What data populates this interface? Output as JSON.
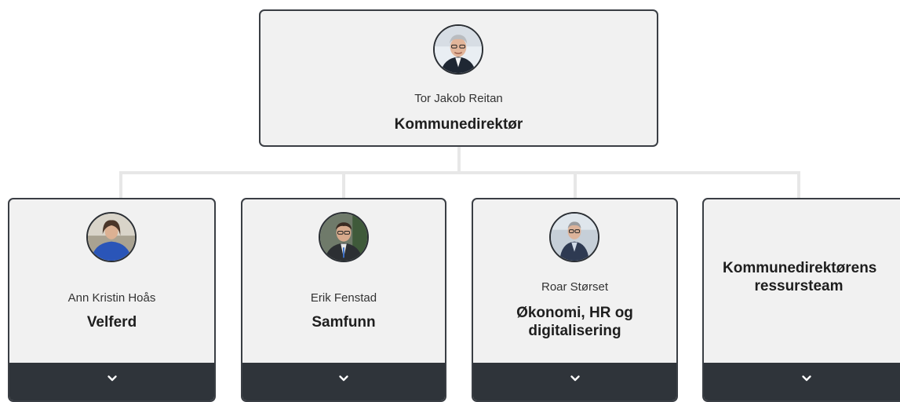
{
  "root": {
    "name": "Tor Jakob Reitan",
    "role": "Kommunedirektør",
    "photo": "person-portrait"
  },
  "children": [
    {
      "name": "Ann Kristin Hoås",
      "role": "Velferd",
      "photo": "person-portrait"
    },
    {
      "name": "Erik Fenstad",
      "role": "Samfunn",
      "photo": "person-portrait"
    },
    {
      "name": "Roar Størset",
      "role": "Økonomi, HR og digitalisering",
      "photo": "person-portrait"
    },
    {
      "name": "",
      "role": "Kommunedirektørens ressursteam",
      "photo": ""
    }
  ],
  "footer": {
    "icon": "chevron-down-icon"
  },
  "colors": {
    "card_bg": "#f1f1f1",
    "card_border": "#3a3e44",
    "footer_bg": "#2f343a",
    "connector": "#e7e7e7"
  }
}
